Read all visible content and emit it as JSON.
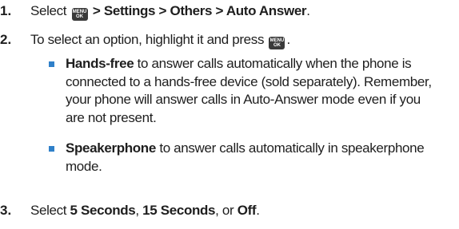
{
  "step1": {
    "number": "1.",
    "prefix": "Select",
    "key": {
      "top": "MENU",
      "bottom": "OK"
    },
    "path": "> Settings > Others > Auto Answer",
    "suffix": "."
  },
  "step2": {
    "number": "2.",
    "text": "To select an option, highlight it and press",
    "key": {
      "top": "MENU",
      "bottom": "OK"
    },
    "suffix": "."
  },
  "bullets": [
    {
      "term": "Hands-free",
      "line1": " to answer calls automatically when the phone is",
      "line2": "connected to a hands-free device (sold separately). Remember,",
      "line3": "your phone will answer calls in Auto-Answer mode even if you",
      "line4": "are not present."
    },
    {
      "term": "Speakerphone",
      "line1": " to answer calls automatically in speakerphone",
      "line2": "mode."
    }
  ],
  "step3": {
    "number": "3.",
    "prefix": "Select ",
    "option1": "5 Seconds",
    "sep1": ", ",
    "option2": "15 Seconds",
    "sep2": ", or ",
    "option3": "Off",
    "suffix": "."
  },
  "colors": {
    "bullet": "#2f80c9",
    "key_bg": "#3a3a3a",
    "text": "#1e1e1e"
  }
}
